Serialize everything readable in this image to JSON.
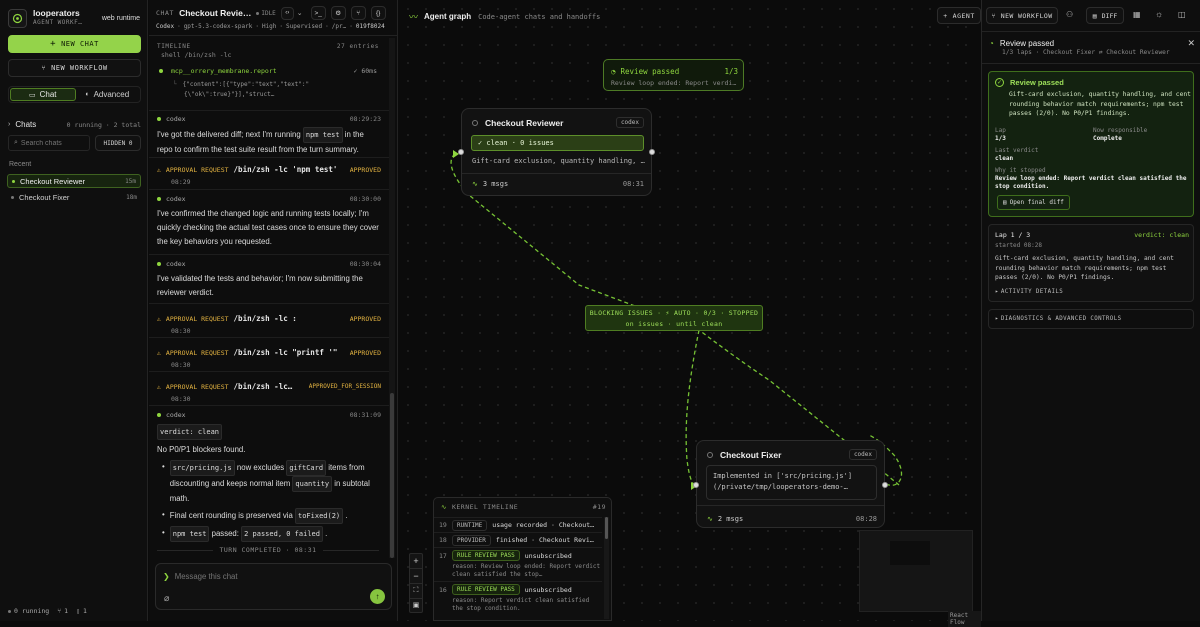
{
  "sidebar": {
    "app_name": "looperators",
    "app_subtitle": "AGENT WORKF…",
    "runtime": "web runtime",
    "new_chat": "NEW CHAT",
    "new_workflow": "NEW WORKFLOW",
    "tab_chat": "Chat",
    "tab_advanced": "Advanced",
    "chats_heading": "Chats",
    "chats_counts": "0 running · 2 total",
    "search_placeholder": "Search chats",
    "hidden_label": "HIDDEN 0",
    "recent_heading": "Recent",
    "items": [
      {
        "label": "Checkout Reviewer",
        "time": "15m"
      },
      {
        "label": "Checkout Fixer",
        "time": "18m"
      }
    ],
    "footer_running": "0 running",
    "footer_branches": "1",
    "footer_files": "1"
  },
  "chat": {
    "label": "CHAT",
    "title": "Checkout Revie…",
    "status": "IDLE",
    "meta_provider": "Codex",
    "meta_model": "gpt-5.3-codex-spark",
    "meta_effort": "High",
    "meta_mode": "Supervised",
    "meta_path": "/pr…",
    "meta_id": "019f8024",
    "timeline_label": "TIMELINE",
    "timeline_count": "27 entries",
    "top_entry_cut": "shell  /bin/zsh -lc",
    "tool_name": "mcp__orrery_membrane.report",
    "tool_duration": "✓ 60ms",
    "tool_output_1": "{\"content\":[{\"type\":\"text\",\"text\":\"",
    "tool_output_2": "{\\\"ok\\\":true}\"}],\"struct…",
    "codex_label": "codex",
    "msg1_time": "08:29:23",
    "msg1_a": "I've got the delivered diff; next I'm running",
    "msg1_code": "npm test",
    "msg1_b": "in the repo to confirm the test suite result from the turn summary.",
    "appr1_label": "APPROVAL REQUEST",
    "appr1_cmd": "/bin/zsh -lc 'npm test'",
    "appr1_status": "APPROVED",
    "appr1_time": "08:29",
    "msg2_time": "08:30:00",
    "msg2": "I've confirmed the changed logic and running tests locally; I'm quickly checking the actual test cases once to ensure they cover the key behaviors you requested.",
    "msg3_time": "08:30:04",
    "msg3": "I've validated the tests and behavior; I'm now submitting the reviewer verdict.",
    "appr2_cmd": "/bin/zsh -lc :",
    "appr2_status": "APPROVED",
    "appr2_time": "08:30",
    "appr3_cmd": "/bin/zsh -lc \"printf '\"",
    "appr3_status": "APPROVED",
    "appr3_time": "08:30",
    "appr4_cmd": "/bin/zsh -lc…",
    "appr4_status": "APPROVED_FOR_SESSION",
    "appr4_time": "08:30",
    "msg4_time": "08:31:09",
    "verdict_code": "verdict: clean",
    "no_blockers": "No P0/P1 blockers found.",
    "b1_file": "src/pricing.js",
    "b1_a": "now excludes",
    "b1_code": "giftCard",
    "b1_b": "items from discounting and keeps normal item",
    "b1_code2": "quantity",
    "b1_c": "in subtotal math.",
    "b2_a": "Final cent rounding is preserved via",
    "b2_code": "toFixed(2)",
    "b2_b": ".",
    "b3_code": "npm test",
    "b3_a": "passed:",
    "b3_code2": "2 passed, 0 failed",
    "b3_b": ".",
    "turn_completed": "TURN COMPLETED · 08:31",
    "composer_placeholder": "Message this chat"
  },
  "canvas": {
    "header_title": "Agent graph",
    "header_subtitle": "Code-agent chats and handoffs",
    "btn_agent": "AGENT",
    "btn_new_workflow": "NEW WORKFLOW",
    "btn_diff": "DIFF",
    "review_passed_title": "Review passed",
    "review_passed_count": "1/3",
    "review_passed_sub": "Review loop ended: Report verdi…",
    "reviewer_title": "Checkout Reviewer",
    "reviewer_tag": "codex",
    "reviewer_status": "✓ clean · 0 issues",
    "reviewer_body": "Gift-card exclusion, quantity handling, …",
    "reviewer_msgs": "3 msgs",
    "reviewer_time": "08:31",
    "blocking_line1": "BLOCKING ISSUES · ⚡ AUTO · 0/3 · STOPPED",
    "blocking_line2": "on issues · until clean",
    "fixer_title": "Checkout Fixer",
    "fixer_tag": "codex",
    "fixer_body_1": "Implemented in ['src/pricing.js']",
    "fixer_body_2": "(/private/tmp/looperators-demo-…",
    "fixer_msgs": "2 msgs",
    "fixer_time": "08:28",
    "kernel_title": "KERNEL TIMELINE",
    "kernel_count": "#19",
    "kernel_rows": [
      {
        "n": "19",
        "tag": "RUNTIME",
        "text": "usage recorded · Checkout…",
        "reason": ""
      },
      {
        "n": "18",
        "tag": "PROVIDER",
        "text": "finished · Checkout Revi…",
        "reason": ""
      },
      {
        "n": "17",
        "tag": "RULE REVIEW PASS",
        "text": "unsubscribed",
        "reason": "reason: Review loop ended: Report verdict clean satisfied the stop…"
      },
      {
        "n": "16",
        "tag": "RULE REVIEW PASS",
        "text": "unsubscribed",
        "reason": "reason: Report verdict clean satisfied the stop condition."
      }
    ],
    "attribution": "React Flow"
  },
  "panel": {
    "title": "Review passed",
    "subtitle": "1/3 laps · Checkout Fixer ⇄ Checkout Reviewer",
    "card_title": "Review passed",
    "card_body": "Gift-card exclusion, quantity handling, and cent rounding behavior match requirements; npm test passes (2/0). No P0/P1 findings.",
    "lap_label": "Lap",
    "lap_value": "1/3",
    "responsible_label": "Now responsible",
    "responsible_value": "Complete",
    "last_verdict_label": "Last verdict",
    "last_verdict_value": "clean",
    "why_label": "Why it stopped",
    "why_value": "Review loop ended: Report verdict clean satisfied the stop condition.",
    "open_diff": "Open final diff",
    "lap_card_title": "Lap 1 / 3",
    "lap_card_verdict": "verdict: clean",
    "lap_card_started": "started 08:28",
    "lap_card_body": "Gift-card exclusion, quantity handling, and cent rounding behavior match requirements; npm test passes (2/0). No P0/P1 findings.",
    "activity_details": "ACTIVITY DETAILS",
    "diagnostics": "DIAGNOSTICS & ADVANCED CONTROLS"
  }
}
